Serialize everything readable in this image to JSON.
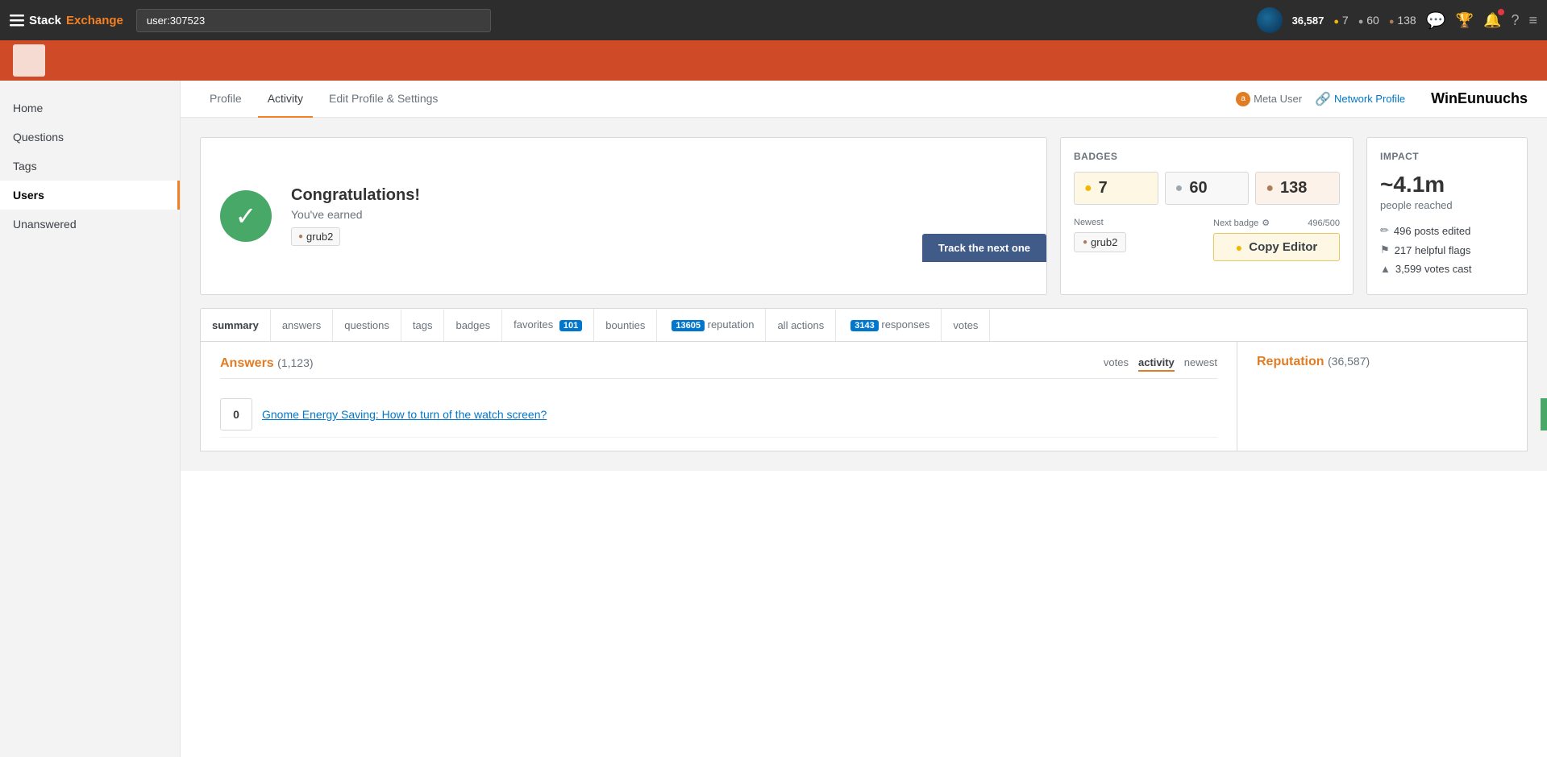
{
  "navbar": {
    "brand": "StackExchange",
    "brand_stack": "Stack",
    "brand_exchange": "Exchange",
    "search_value": "user:307523",
    "reputation": "36,587",
    "gold_count": "7",
    "silver_count": "60",
    "bronze_count": "138"
  },
  "tabs": {
    "profile_label": "Profile",
    "activity_label": "Activity",
    "edit_profile_label": "Edit Profile & Settings",
    "meta_user_label": "Meta User",
    "network_profile_label": "Network Profile",
    "username": "WinEunuuchs"
  },
  "sidebar": {
    "items": [
      {
        "label": "Home"
      },
      {
        "label": "Questions"
      },
      {
        "label": "Tags"
      },
      {
        "label": "Users"
      },
      {
        "label": "Unanswered"
      }
    ]
  },
  "congrats": {
    "title": "Congratulations!",
    "subtitle": "You've earned",
    "badge_name": "grub2"
  },
  "badges": {
    "panel_title": "BADGES",
    "gold": "7",
    "silver": "60",
    "bronze": "138",
    "newest_label": "Newest",
    "newest_badge": "grub2",
    "next_badge_label": "Next badge",
    "next_badge_progress": "496/500",
    "next_badge_name": "Copy Editor"
  },
  "impact": {
    "panel_title": "IMPACT",
    "number": "~4.1m",
    "label": "people reached",
    "stat1": "496 posts edited",
    "stat2": "217 helpful flags",
    "stat3": "3,599 votes cast"
  },
  "activity_tabs": [
    {
      "label": "summary",
      "active": true,
      "badge": null
    },
    {
      "label": "answers",
      "active": false,
      "badge": null
    },
    {
      "label": "questions",
      "active": false,
      "badge": null
    },
    {
      "label": "tags",
      "active": false,
      "badge": null
    },
    {
      "label": "badges",
      "active": false,
      "badge": null
    },
    {
      "label": "favorites",
      "active": false,
      "badge": "101"
    },
    {
      "label": "bounties",
      "active": false,
      "badge": null
    },
    {
      "label": "reputation",
      "active": false,
      "badge": "13605"
    },
    {
      "label": "all actions",
      "active": false,
      "badge": null
    },
    {
      "label": "responses",
      "active": false,
      "badge": "3143"
    },
    {
      "label": "votes",
      "active": false,
      "badge": null
    }
  ],
  "answers_section": {
    "title": "Answers",
    "count": "(1,123)",
    "sort_votes": "votes",
    "sort_activity": "activity",
    "sort_newest": "newest"
  },
  "answer_row": {
    "votes": "0",
    "title": "Gnome Energy Saving: How to turn of the watch screen?"
  },
  "reputation_section": {
    "title": "Reputation",
    "count": "(36,587)"
  }
}
